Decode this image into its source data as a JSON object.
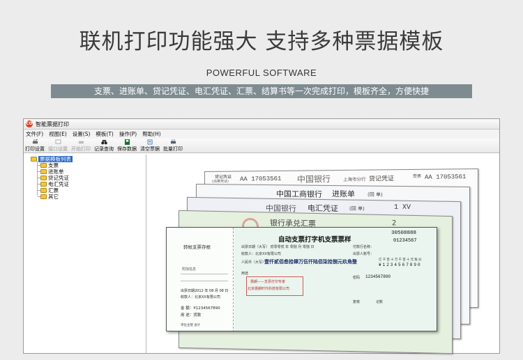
{
  "hero": {
    "title": "联机打印功能强大  支持多种票据模板",
    "subtitle": "POWERFUL SOFTWARE",
    "banner": "支票、进账单、贷记凭证、电汇凭证、汇票、结算书等一次完成打印，模板齐全，方便快捷"
  },
  "window": {
    "title": "智能票据打印",
    "icon_label": "CO",
    "menu": [
      "文件(F)",
      "视图(E)",
      "设置(S)",
      "模板(T)",
      "操作(P)",
      "帮助(H)"
    ],
    "toolbar": [
      {
        "label": "打印设置",
        "icon": "printer-settings-icon",
        "enabled": true
      },
      {
        "label": "接口设置",
        "icon": "interface-icon",
        "enabled": false
      },
      {
        "label": "开始打印",
        "icon": "print-icon",
        "enabled": false
      },
      {
        "label": "记录查询",
        "icon": "binoculars-icon",
        "enabled": true
      },
      {
        "label": "保存数据",
        "icon": "save-icon",
        "enabled": true
      },
      {
        "label": "清空票据",
        "icon": "clear-icon",
        "enabled": true
      },
      {
        "label": "批量打印",
        "icon": "batch-print-icon",
        "enabled": true
      }
    ],
    "tree": {
      "root": "票据模板列表",
      "items": [
        "支票",
        "进账单",
        "贷记凭证",
        "电汇凭证",
        "汇票",
        "其它"
      ]
    }
  },
  "tickets": {
    "credit": {
      "left_label": "贷记凭证",
      "left_sub": "(出票凭证)",
      "number": "AA 17053561",
      "bank": "中国银行",
      "branch": "上海市分行",
      "type": "贷记凭证",
      "right_label": "受票",
      "number2": "AA 17053561"
    },
    "deposit": {
      "bank": "中国工商银行",
      "type": "进账单",
      "suffix": "(回 单)"
    },
    "wire": {
      "bank": "中国银行",
      "type": "电汇凭证",
      "suffix": "(回 单)",
      "number": "1 XV"
    },
    "draft": {
      "type": "银行承兑汇票",
      "number": "2"
    },
    "cheque": {
      "stub_title": "转帐支票存根",
      "stub_extra": "附加信息",
      "stub_date": "出票日期2012 年 08 月 08 日",
      "stub_payee": "收款人：北京XX有限公司",
      "stub_amount": "金  额：¥1234567890",
      "stub_use": "用  途：货款",
      "stub_unit": "单位主管          会计",
      "title": "自动支票打字机支票票样",
      "serial": "30508888",
      "serial2": "01234567",
      "date_line": "出票日期（大写）   贰零零贰  年  零捌  月  零捌  日",
      "payer_bank": "付款行名称：",
      "payee": "收款人：北京XX有限公司",
      "payer_acct": "出票人账号：",
      "amount_label": "人民币（大写）",
      "amount_words": "壹仟贰佰叁拾肆万伍仟陆佰柒拾捌元玖角整",
      "digits_header": "亿千百十万千百十元角分",
      "digits": "¥1234567890",
      "use_label": "用途",
      "seal_line1": "惠朗——支票打印专家",
      "seal_line2": "北京惠朗时代科技有限公司",
      "password": "密码",
      "password_val": "1234567890",
      "review": "复核",
      "book": "记账"
    }
  }
}
